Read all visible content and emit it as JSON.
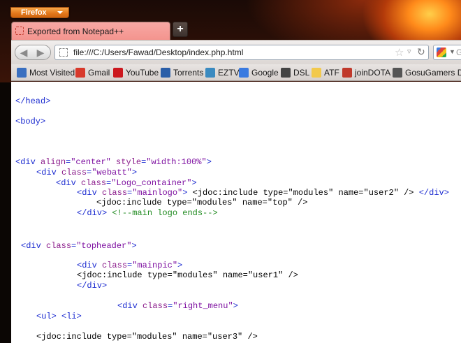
{
  "app_button": {
    "label": "Firefox"
  },
  "tab": {
    "title": "Exported from Notepad++",
    "new_tab_label": "+"
  },
  "nav": {
    "back_icon": "back-arrow-icon",
    "forward_icon": "forward-arrow-icon",
    "url": "file:///C:/Users/Fawad/Desktop/index.php.html",
    "search_hint": "G"
  },
  "bookmarks": [
    {
      "label": "Most Visited",
      "icon": "most-visited-icon",
      "color": "#3a6fc0"
    },
    {
      "label": "Gmail",
      "icon": "gmail-icon",
      "color": "#d8392b"
    },
    {
      "label": "YouTube",
      "icon": "youtube-icon",
      "color": "#cc181e"
    },
    {
      "label": "Torrents",
      "icon": "torrents-icon",
      "color": "#2a5ea8"
    },
    {
      "label": "EZTV",
      "icon": "eztv-icon",
      "color": "#3a8ac0"
    },
    {
      "label": "Google",
      "icon": "google-icon",
      "color": "#3a7ae0"
    },
    {
      "label": "DSL",
      "icon": "dsl-icon",
      "color": "#444444"
    },
    {
      "label": "ATF",
      "icon": "folder-icon",
      "color": "#f2c94c"
    },
    {
      "label": "joinDOTA",
      "icon": "joindota-icon",
      "color": "#c0392b"
    },
    {
      "label": "GosuGamers Dota",
      "icon": "gosugamers-icon",
      "color": "#555555"
    }
  ],
  "code_lines": [
    {
      "segments": [
        {
          "t": "tag",
          "v": "</head>"
        }
      ]
    },
    {
      "segments": [
        {
          "t": "tag",
          "v": "<body>"
        }
      ]
    },
    {
      "segments": [
        {
          "t": "tag",
          "v": "<div "
        },
        {
          "t": "attr",
          "v": "align"
        },
        {
          "t": "tag",
          "v": "="
        },
        {
          "t": "val",
          "v": "\"center\" "
        },
        {
          "t": "attr",
          "v": "style"
        },
        {
          "t": "tag",
          "v": "="
        },
        {
          "t": "val",
          "v": "\"width:100%\""
        },
        {
          "t": "tag",
          "v": ">"
        }
      ]
    },
    {
      "segments": [
        {
          "t": "tag",
          "v": "<div "
        },
        {
          "t": "attr",
          "v": "class"
        },
        {
          "t": "tag",
          "v": "="
        },
        {
          "t": "val",
          "v": "\"webatt\""
        },
        {
          "t": "tag",
          "v": ">"
        }
      ]
    },
    {
      "segments": [
        {
          "t": "tag",
          "v": "<div "
        },
        {
          "t": "attr",
          "v": "class"
        },
        {
          "t": "tag",
          "v": "="
        },
        {
          "t": "val",
          "v": "\"Logo_container\""
        },
        {
          "t": "tag",
          "v": ">"
        }
      ]
    },
    {
      "segments": [
        {
          "t": "tag",
          "v": "<div "
        },
        {
          "t": "attr",
          "v": "class"
        },
        {
          "t": "tag",
          "v": "="
        },
        {
          "t": "val",
          "v": "\"mainlogo\""
        },
        {
          "t": "tag",
          "v": "> "
        },
        {
          "t": "txt",
          "v": "<jdoc:include type=\"modules\" name=\"user2\" /> "
        },
        {
          "t": "tag",
          "v": "</div>"
        }
      ]
    },
    {
      "segments": [
        {
          "t": "txt",
          "v": "<jdoc:include type=\"modules\" name=\"top\" />"
        }
      ]
    },
    {
      "segments": [
        {
          "t": "tag",
          "v": "</div> "
        },
        {
          "t": "cmt",
          "v": "<!--main logo ends-->"
        }
      ]
    },
    {
      "segments": [
        {
          "t": "tag",
          "v": "<div "
        },
        {
          "t": "attr",
          "v": "class"
        },
        {
          "t": "tag",
          "v": "="
        },
        {
          "t": "val",
          "v": "\"topheader\""
        },
        {
          "t": "tag",
          "v": ">"
        }
      ]
    },
    {
      "segments": [
        {
          "t": "tag",
          "v": "<div "
        },
        {
          "t": "attr",
          "v": "class"
        },
        {
          "t": "tag",
          "v": "="
        },
        {
          "t": "val",
          "v": "\"mainpic\""
        },
        {
          "t": "tag",
          "v": ">"
        }
      ]
    },
    {
      "segments": [
        {
          "t": "txt",
          "v": "<jdoc:include type=\"modules\" name=\"user1\" />"
        }
      ]
    },
    {
      "segments": [
        {
          "t": "tag",
          "v": "</div>"
        }
      ]
    },
    {
      "segments": [
        {
          "t": "tag",
          "v": "<div "
        },
        {
          "t": "attr",
          "v": "class"
        },
        {
          "t": "tag",
          "v": "="
        },
        {
          "t": "val",
          "v": "\"right_menu\""
        },
        {
          "t": "tag",
          "v": ">"
        }
      ]
    },
    {
      "segments": [
        {
          "t": "tag",
          "v": "<ul> <li>"
        }
      ]
    },
    {
      "segments": [
        {
          "t": "txt",
          "v": "<jdoc:include type=\"modules\" name=\"user3\" />"
        }
      ]
    }
  ]
}
